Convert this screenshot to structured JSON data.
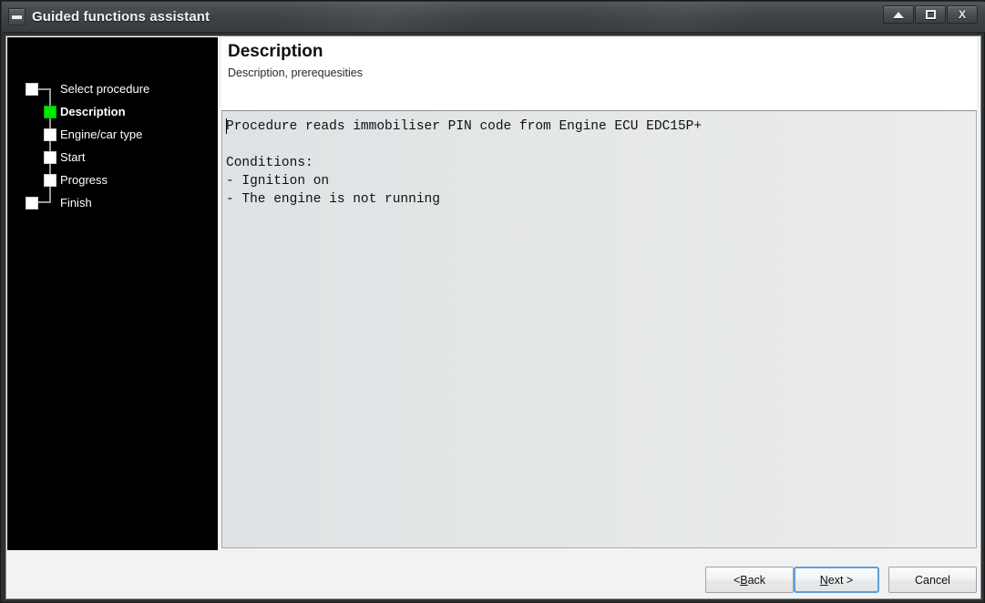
{
  "window": {
    "title": "Guided functions assistant",
    "icon": "window-menu-icon",
    "controls": {
      "minimize_label": "▲",
      "maximize_label": "□",
      "close_label": "X"
    }
  },
  "sidebar": {
    "items": [
      {
        "label": "Select procedure",
        "state": "pending",
        "level": 0
      },
      {
        "label": "Description",
        "state": "active",
        "level": 1
      },
      {
        "label": "Engine/car type",
        "state": "pending",
        "level": 1
      },
      {
        "label": "Start",
        "state": "pending",
        "level": 1
      },
      {
        "label": "Progress",
        "state": "pending",
        "level": 1
      },
      {
        "label": "Finish",
        "state": "pending",
        "level": 0
      }
    ],
    "active_color": "#00e800",
    "pending_color": "#ffffff"
  },
  "header": {
    "title": "Description",
    "subtitle": "Description, prerequesities"
  },
  "main": {
    "body_text": "Procedure reads immobiliser PIN code from Engine ECU EDC15P+\n\nConditions:\n- Ignition on\n- The engine is not running"
  },
  "footer": {
    "back": {
      "prefix": "< ",
      "mnemonic": "B",
      "suffix": "ack"
    },
    "next": {
      "prefix": "",
      "mnemonic": "N",
      "suffix": "ext >"
    },
    "cancel_label": "Cancel",
    "focused_button": "next"
  }
}
